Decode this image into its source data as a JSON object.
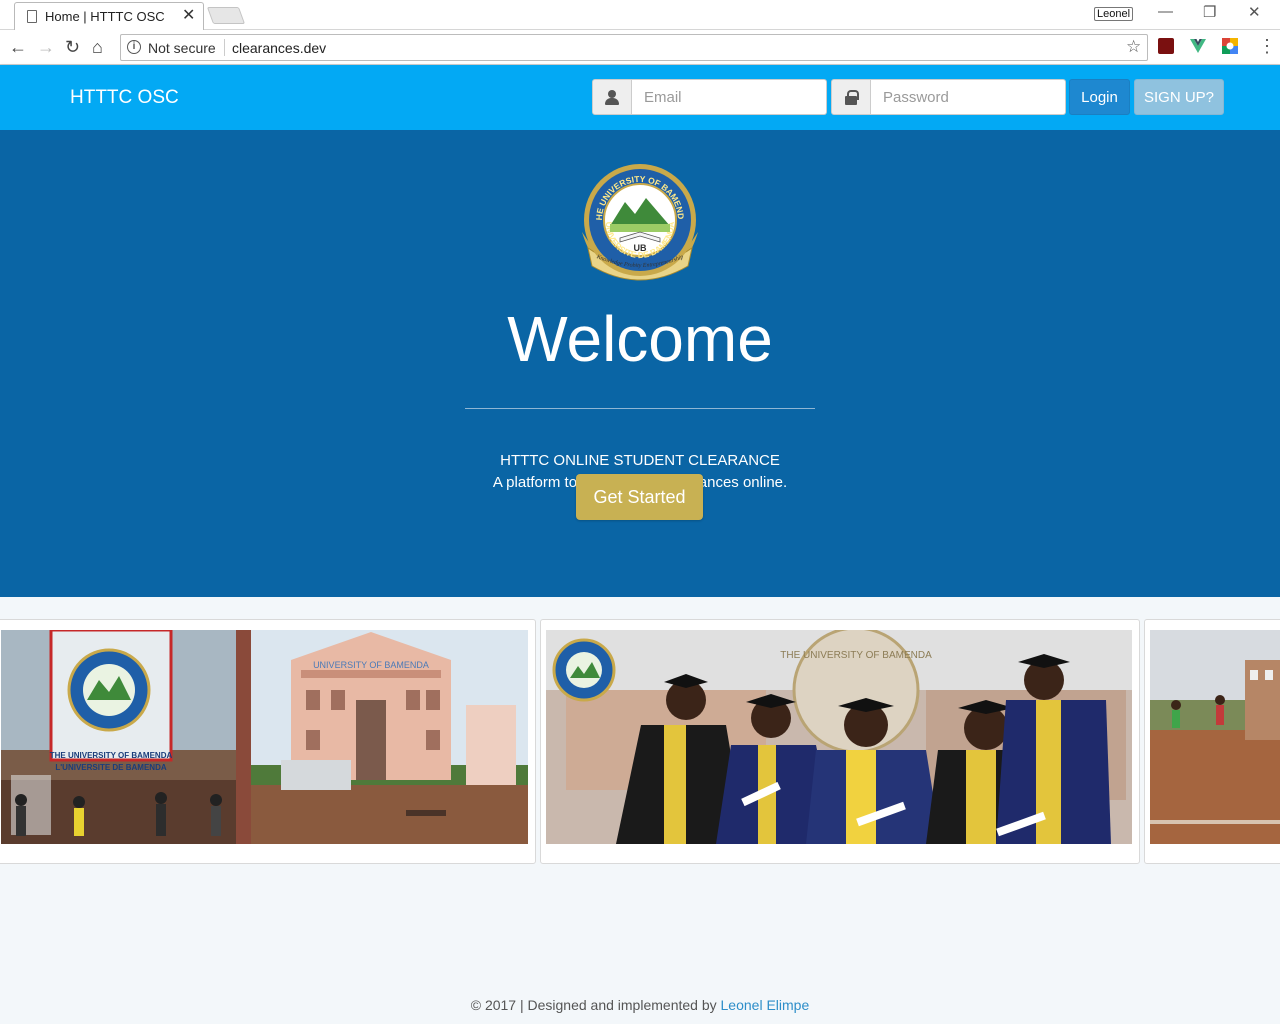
{
  "browser": {
    "tab_title": "Home | HTTTC OSC",
    "tab_close": "✕",
    "profile_name": "Leonel",
    "security_label": "Not secure",
    "url": "clearances.dev"
  },
  "navbar": {
    "brand": "HTTTC OSC",
    "email_placeholder": "Email",
    "password_placeholder": "Password",
    "login_label": "Login",
    "signup_label": "SIGN UP?"
  },
  "hero": {
    "seal_ring_top": "THE UNIVERSITY OF BAMENDA",
    "seal_ring_bottom": "UNIVERSITE DE BAMENDA",
    "seal_center": "UB",
    "seal_motto": "Knowledge Probity Entrepreneurship",
    "welcome": "Welcome",
    "title": "HTTTC ONLINE STUDENT CLEARANCE",
    "subtitle": "A platform to sign student clearances online.",
    "cta_label": "Get Started"
  },
  "gallery": {
    "photo1_sign": "THE UNIVERSITY OF BAMENDA",
    "photo1_sign2": "L'UNIVERSITE DE BAMENDA",
    "photo1_building": "UNIVERSITY OF BAMENDA",
    "photo2_seal_text": "THE UNIVERSITY OF BAMENDA"
  },
  "footer": {
    "text": "© 2017 | Designed and implemented by",
    "author": "Leonel Elimpe"
  },
  "colors": {
    "navbar": "#03a9f4",
    "hero": "#0a65a5",
    "cta": "#c8b153",
    "login": "#1e88d0",
    "signup": "#8fc2df"
  }
}
